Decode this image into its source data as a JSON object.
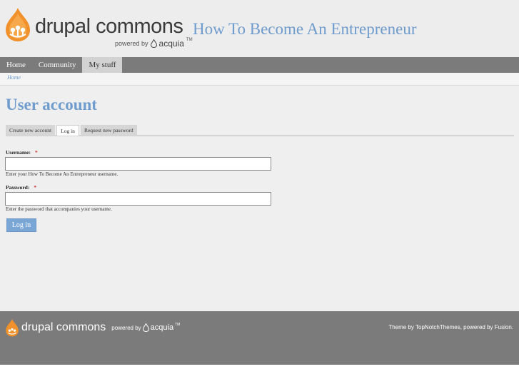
{
  "header": {
    "logo_text": "drupal commons",
    "logo_powered_by": "powered by",
    "logo_acquia": "acquia",
    "logo_tm": "TM",
    "site_name": "How To Become An Entrepreneur"
  },
  "nav": {
    "items": [
      {
        "label": "Home"
      },
      {
        "label": "Community"
      },
      {
        "label": "My stuff"
      }
    ],
    "active_index": 2
  },
  "breadcrumb": {
    "home": "Home"
  },
  "main": {
    "title": "User account",
    "tabs": [
      {
        "label": "Create new account"
      },
      {
        "label": "Log in"
      },
      {
        "label": "Request new password"
      }
    ],
    "active_tab": 1,
    "username": {
      "label": "Username:",
      "required_mark": "*",
      "value": "",
      "description": "Enter your How To Become An Entrepreneur username."
    },
    "password": {
      "label": "Password:",
      "required_mark": "*",
      "value": "",
      "description": "Enter the password that accompanies your username."
    },
    "submit_label": "Log in"
  },
  "footer": {
    "logo_text": "drupal commons",
    "powered_by": "powered by",
    "acquia": "acquia",
    "tm": "TM",
    "credit_prefix": "Theme by ",
    "credit_theme": "TopNotchThemes",
    "credit_middle": ", powered by ",
    "credit_fusion": "Fusion",
    "credit_suffix": "."
  },
  "colors": {
    "accent": "#6f9ccd",
    "nav_bg": "#7b7b7b",
    "drop_orange": "#f0912b",
    "button_bg": "#7aa6d6"
  },
  "icons": {
    "logo": "drupal-drop-icon",
    "acquia": "acquia-drop-icon"
  }
}
